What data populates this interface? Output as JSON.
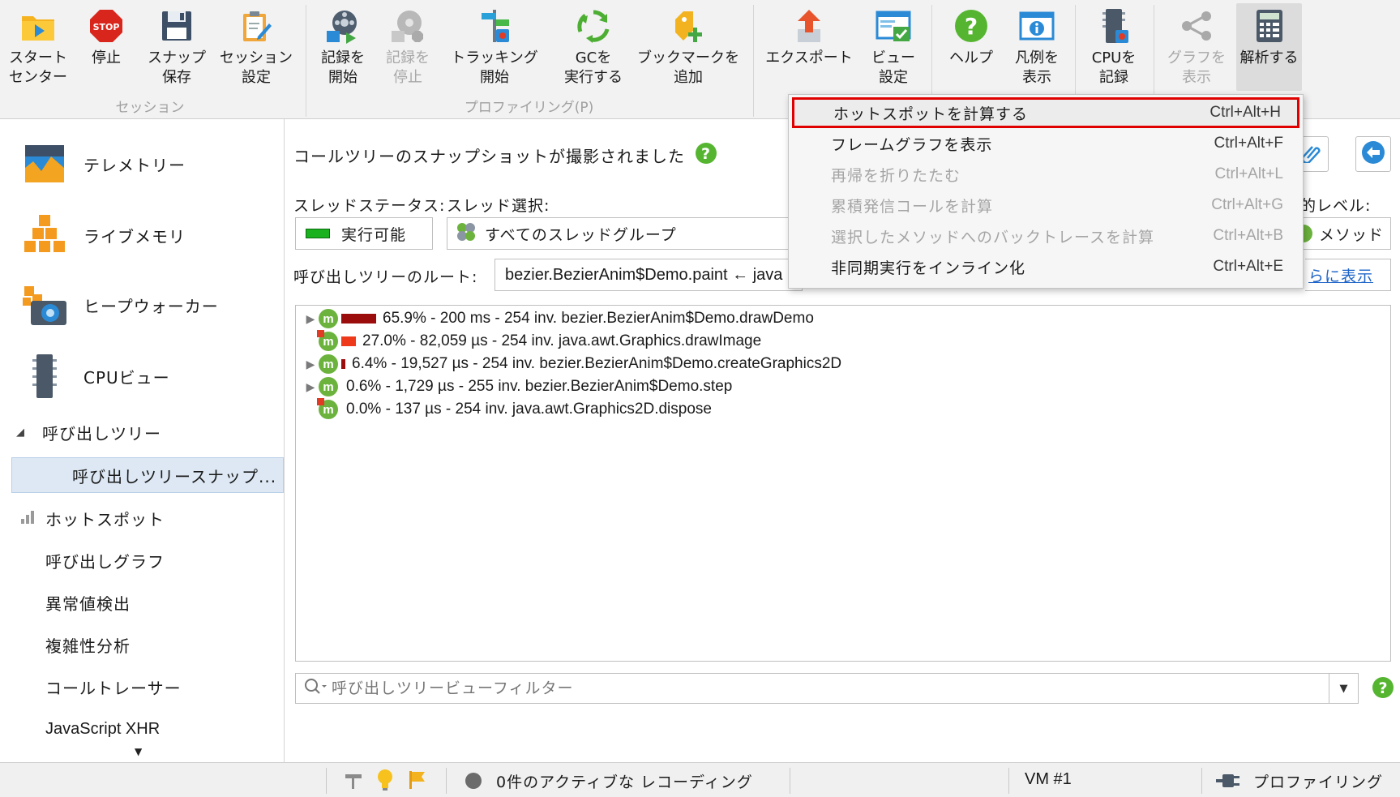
{
  "toolbar": {
    "session": {
      "group_label": "セッション",
      "start_center": "スタート\nセンター",
      "stop": "停止",
      "snapshot_save": "スナップ\n保存",
      "session_settings": "セッション\n設定"
    },
    "profiling": {
      "group_label": "プロファイリング(P)",
      "start_recording": "記録を\n開始",
      "stop_recording": "記録を\n停止",
      "start_tracking": "トラッキング\n開始",
      "run_gc": "GCを\n実行する",
      "add_bookmark": "ブックマークを\n追加"
    },
    "export": "エクスポート",
    "view_settings": "ビュー\n設定",
    "help": "ヘルプ",
    "show_legend": "凡例を\n表示",
    "record_cpu": "CPUを\n記録",
    "show_graph": "グラフを\n表示",
    "analyze": "解析する",
    "stop_icon_text": "STOP"
  },
  "sidebar": {
    "telemetry": "テレメトリー",
    "live_memory": "ライブメモリ",
    "heap_walker": "ヒープウォーカー",
    "cpu_view": "CPUビュー",
    "call_tree": "呼び出しツリー",
    "call_tree_snapshot": "呼び出しツリースナップ...",
    "hotspots": "ホットスポット",
    "call_graph": "呼び出しグラフ",
    "outlier_detection": "異常値検出",
    "complexity_analysis": "複雑性分析",
    "call_tracer": "コールトレーサー",
    "javascript_xhr": "JavaScript XHR"
  },
  "main": {
    "snapshot_message": "コールツリーのスナップショットが撮影されました",
    "thread_status_label": "スレッドステータス:",
    "thread_select_label": "スレッド選択:",
    "thread_status_value": "実行可能",
    "thread_select_value": "すべてのスレッドグループ",
    "aggregation_label_partial": "的レベル:",
    "aggregation_value_partial": "メソッド",
    "root_label": "呼び出しツリーのルート:",
    "root_value": "bezier.BezierAnim$Demo.paint ← java",
    "show_more_partial": "らに表示",
    "filter_placeholder": "呼び出しツリービューフィルター"
  },
  "tree": [
    {
      "text": "65.9% - 200 ms - 254 inv. bezier.BezierAnim$Demo.drawDemo",
      "percent": 65.9,
      "expandable": true,
      "bar_color": "#9b0d0d"
    },
    {
      "text": "27.0% - 82,059 µs - 254 inv. java.awt.Graphics.drawImage",
      "percent": 27.0,
      "expandable": false,
      "bar_color": "#ee3a1a"
    },
    {
      "text": "6.4% - 19,527 µs - 254 inv. bezier.BezierAnim$Demo.createGraphics2D",
      "percent": 6.4,
      "expandable": true,
      "bar_color": "#9b0d0d"
    },
    {
      "text": "0.6% - 1,729 µs - 255 inv. bezier.BezierAnim$Demo.step",
      "percent": 0.6,
      "expandable": true,
      "bar_color": "#9b0d0d"
    },
    {
      "text": "0.0% - 137 µs - 254 inv. java.awt.Graphics2D.dispose",
      "percent": 0.0,
      "expandable": false,
      "bar_color": "#9b0d0d"
    }
  ],
  "menu": [
    {
      "label": "ホットスポットを計算する",
      "shortcut": "Ctrl+Alt+H",
      "enabled": true,
      "highlighted": true
    },
    {
      "label": "フレームグラフを表示",
      "shortcut": "Ctrl+Alt+F",
      "enabled": true
    },
    {
      "label": "再帰を折りたたむ",
      "shortcut": "Ctrl+Alt+L",
      "enabled": false
    },
    {
      "label": "累積発信コールを計算",
      "shortcut": "Ctrl+Alt+G",
      "enabled": false
    },
    {
      "label": "選択したメソッドへのバックトレースを計算",
      "shortcut": "Ctrl+Alt+B",
      "enabled": false
    },
    {
      "label": "非同期実行をインライン化",
      "shortcut": "Ctrl+Alt+E",
      "enabled": true
    }
  ],
  "statusbar": {
    "recordings": "0件のアクティブな レコーディング",
    "vm": "VM #1",
    "profiling": "プロファイリング"
  },
  "colors": {
    "highlight_border": "#e00000",
    "selected_nav": "#dde8f4",
    "method_icon": "#6cb33e",
    "runnable_green": "#19b21e"
  }
}
